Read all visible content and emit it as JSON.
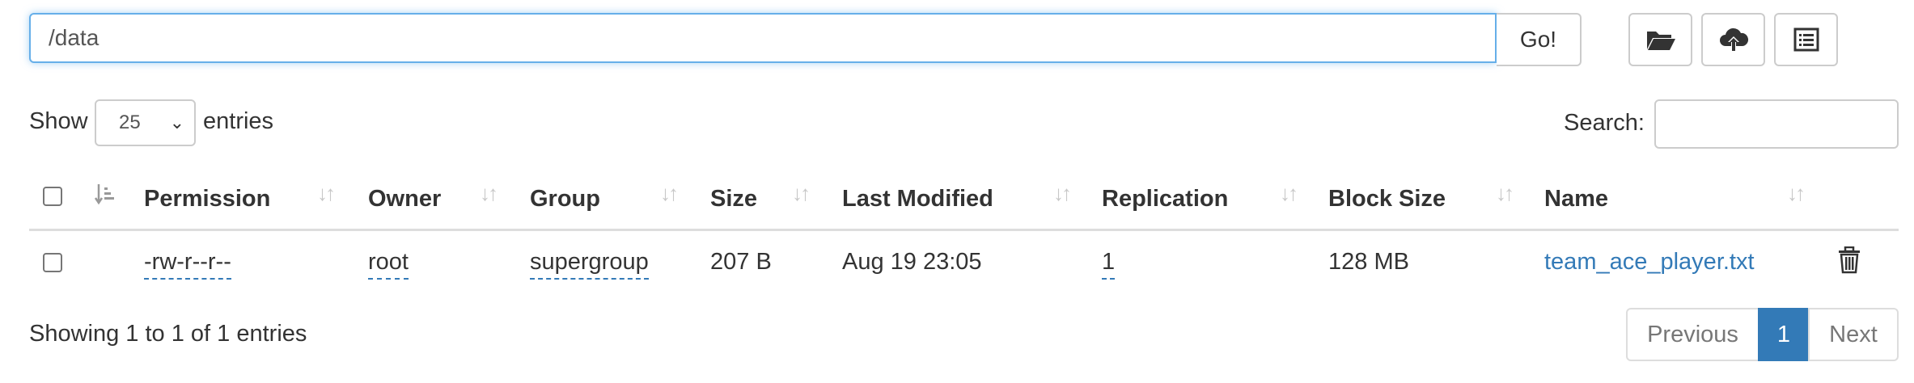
{
  "path_bar": {
    "value": "/data",
    "go_label": "Go!"
  },
  "toolbar": {
    "create_directory_icon": "folder-open-icon",
    "upload_icon": "cloud-upload-icon",
    "cut_paste_icon": "list-alt-icon"
  },
  "controls": {
    "show_label": "Show",
    "entries_value": "25",
    "entries_label": "entries",
    "search_label": "Search:",
    "search_value": ""
  },
  "table": {
    "columns": [
      "Permission",
      "Owner",
      "Group",
      "Size",
      "Last Modified",
      "Replication",
      "Block Size",
      "Name"
    ],
    "rows": [
      {
        "permission": "-rw-r--r--",
        "owner": "root",
        "group": "supergroup",
        "size": "207 B",
        "last_modified": "Aug 19 23:05",
        "replication": "1",
        "block_size": "128 MB",
        "name": "team_ace_player.txt"
      }
    ]
  },
  "footer": {
    "info": "Showing 1 to 1 of 1 entries",
    "previous_label": "Previous",
    "current_page": "1",
    "next_label": "Next"
  },
  "colors": {
    "link": "#337ab7",
    "focus": "#66afe9",
    "active_page": "#337ab7"
  }
}
